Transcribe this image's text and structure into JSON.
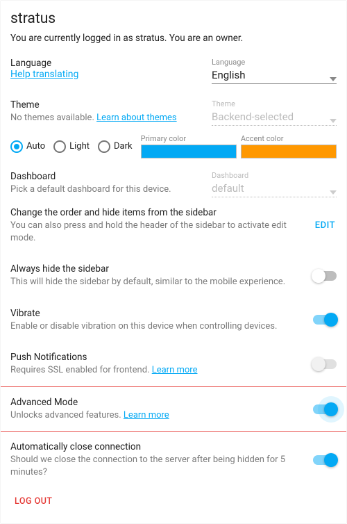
{
  "header": {
    "username": "stratus",
    "status": "You are currently logged in as stratus. You are an owner."
  },
  "language": {
    "label": "Language",
    "help_link": "Help translating",
    "select_label": "Language",
    "value": "English"
  },
  "theme": {
    "label": "Theme",
    "none_text": "No themes available. ",
    "learn_link": "Learn about themes",
    "select_label": "Theme",
    "value": "Backend-selected",
    "radios": {
      "auto": "Auto",
      "light": "Light",
      "dark": "Dark"
    },
    "primary_label": "Primary color",
    "primary_color": "#03a9f4",
    "accent_label": "Accent color",
    "accent_color": "#ff9800"
  },
  "dashboard": {
    "label": "Dashboard",
    "desc": "Pick a default dashboard for this device.",
    "select_label": "Dashboard",
    "value": "default"
  },
  "sidebar_order": {
    "title": "Change the order and hide items from the sidebar",
    "desc": "You can also press and hold the header of the sidebar to activate edit mode.",
    "edit": "EDIT"
  },
  "hide_sidebar": {
    "title": "Always hide the sidebar",
    "desc": "This will hide the sidebar by default, similar to the mobile experience.",
    "on": false
  },
  "vibrate": {
    "title": "Vibrate",
    "desc": "Enable or disable vibration on this device when controlling devices.",
    "on": true
  },
  "push": {
    "title": "Push Notifications",
    "desc_prefix": "Requires SSL enabled for frontend. ",
    "learn": "Learn more",
    "on": false
  },
  "advanced": {
    "title": "Advanced Mode",
    "desc_prefix": "Unlocks advanced features. ",
    "learn": "Learn more",
    "on": true,
    "halo": true
  },
  "autoclose": {
    "title": "Automatically close connection",
    "desc": "Should we close the connection to the server after being hidden for 5 minutes?",
    "on": true
  },
  "logout": "LOG OUT"
}
